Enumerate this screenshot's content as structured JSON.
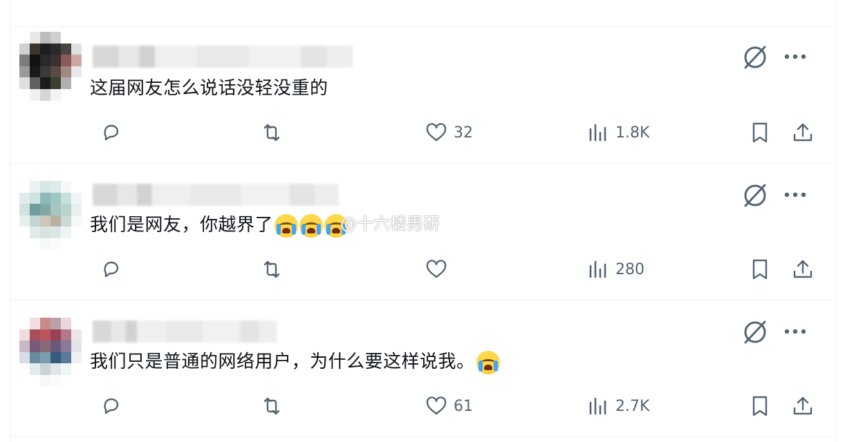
{
  "posts": [
    {
      "text": "这届网友怎么说话没轻没重的",
      "emoji_count": 0,
      "replies": "",
      "reposts": "",
      "likes": "32",
      "views": "1.8K"
    },
    {
      "text": "我们是网友，你越界了",
      "emoji_count": 3,
      "replies": "",
      "reposts": "",
      "likes": "",
      "views": "280"
    },
    {
      "text": "我们只是普通的网络用户，为什么要这样说我。",
      "emoji_count": 1,
      "replies": "",
      "reposts": "",
      "likes": "61",
      "views": "2.7K"
    }
  ],
  "watermark": "@十六楼男研",
  "icons": {
    "grok": "grok-icon",
    "more": "more-icon",
    "reply": "reply-icon",
    "repost": "repost-icon",
    "like": "heart-icon",
    "views": "analytics-icon",
    "bookmark": "bookmark-icon",
    "share": "share-icon"
  },
  "colors": {
    "text": "#0f1419",
    "muted": "#536471",
    "border": "#eff3f4"
  }
}
